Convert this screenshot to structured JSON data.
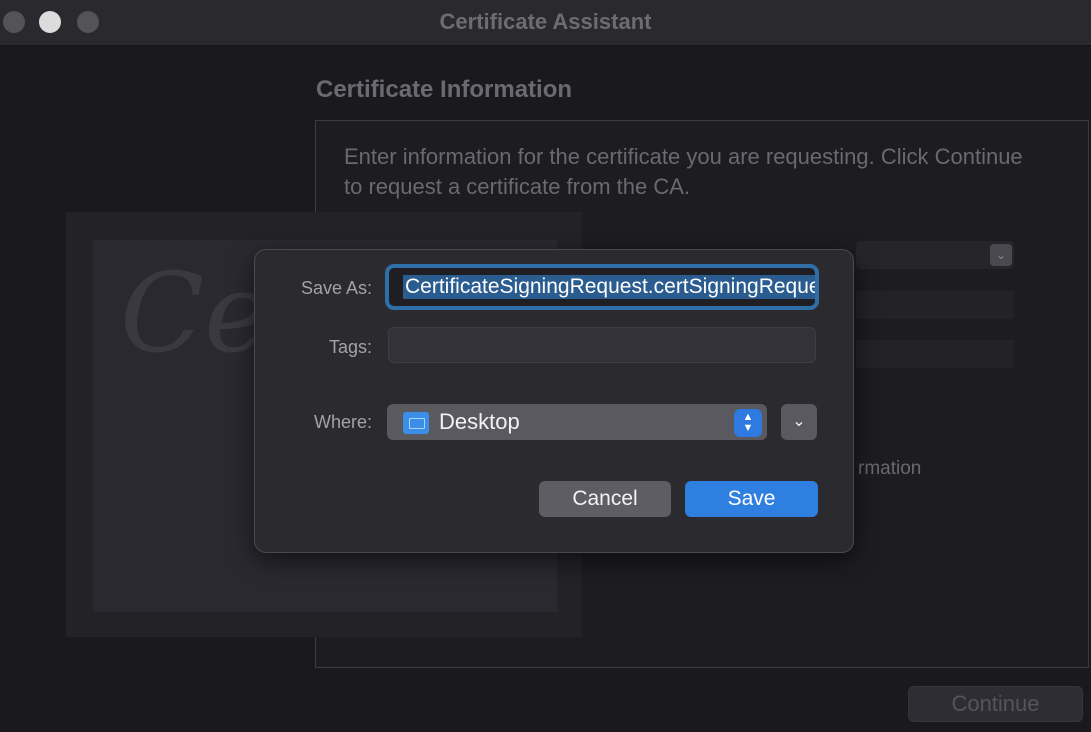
{
  "window": {
    "title": "Certificate Assistant"
  },
  "assistant": {
    "heading": "Certificate Information",
    "instructions": "Enter information for the certificate you are requesting. Click Continue to request a certificate from the CA.",
    "certificate_glyph": "Ce",
    "partial_option_text": "rmation",
    "continue_label": "Continue"
  },
  "save_sheet": {
    "save_as_label": "Save As:",
    "save_as_value": "CertificateSigningRequest.certSigningRequest",
    "tags_label": "Tags:",
    "tags_value": "",
    "where_label": "Where:",
    "where_value": "Desktop",
    "cancel_label": "Cancel",
    "save_label": "Save"
  },
  "icons": {
    "stepper": "⌃⌄",
    "expand": "⌄",
    "popup_arrow": "⌄"
  },
  "colors": {
    "accent": "#2f7fe0",
    "focus_ring": "#2f6fa8",
    "folder": "#3a8ee8"
  }
}
